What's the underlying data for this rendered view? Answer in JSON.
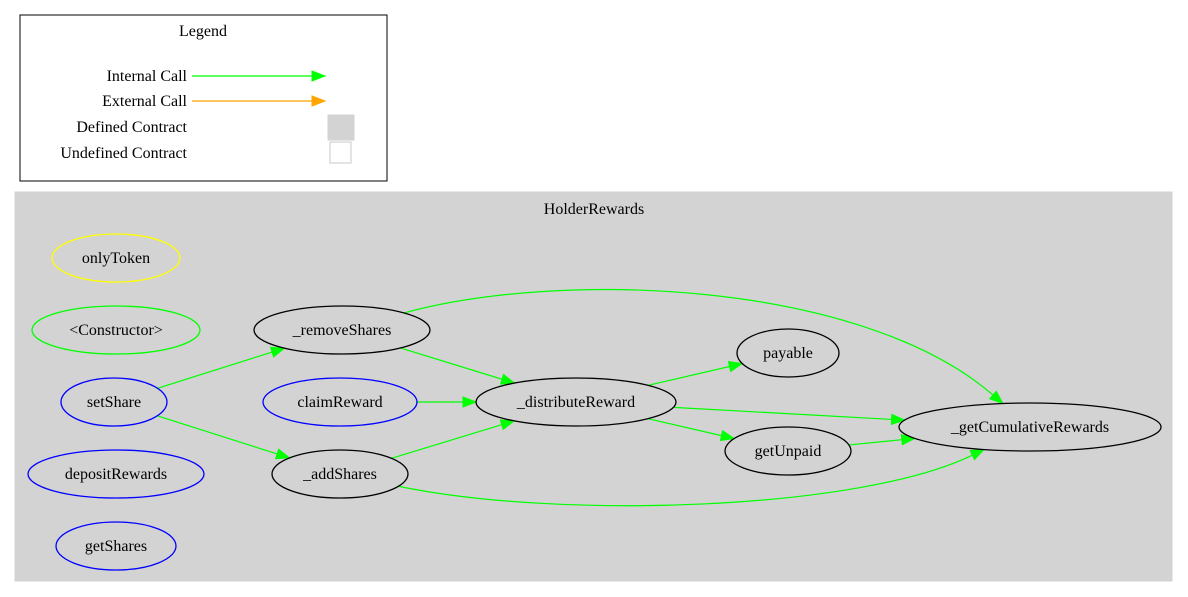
{
  "legend": {
    "title": "Legend",
    "items": [
      {
        "label": "Internal Call",
        "kind": "arrow",
        "color": "#00ff00"
      },
      {
        "label": "External Call",
        "kind": "arrow",
        "color": "#ffa500"
      },
      {
        "label": "Defined Contract",
        "kind": "box",
        "fill": "#d3d3d3",
        "stroke": "#d3d3d3"
      },
      {
        "label": "Undefined Contract",
        "kind": "box",
        "fill": "#ffffff",
        "stroke": "#d3d3d3"
      }
    ]
  },
  "cluster": {
    "title": "HolderRewards",
    "fill": "#d3d3d3"
  },
  "node_colors": {
    "modifier": "#ffff00",
    "constructor": "#00ff00",
    "public": "#0000ff",
    "internal": "#000000"
  },
  "edge_color": "#00ff00",
  "nodes": [
    {
      "id": "onlyToken",
      "label": "onlyToken",
      "type": "modifier"
    },
    {
      "id": "constructor",
      "label": "<Constructor>",
      "type": "constructor"
    },
    {
      "id": "setShare",
      "label": "setShare",
      "type": "public"
    },
    {
      "id": "depositRewards",
      "label": "depositRewards",
      "type": "public"
    },
    {
      "id": "getShares",
      "label": "getShares",
      "type": "public"
    },
    {
      "id": "_removeShares",
      "label": "_removeShares",
      "type": "internal"
    },
    {
      "id": "claimReward",
      "label": "claimReward",
      "type": "public"
    },
    {
      "id": "_addShares",
      "label": "_addShares",
      "type": "internal"
    },
    {
      "id": "_distributeReward",
      "label": "_distributeReward",
      "type": "internal"
    },
    {
      "id": "payable",
      "label": "payable",
      "type": "internal"
    },
    {
      "id": "getUnpaid",
      "label": "getUnpaid",
      "type": "internal"
    },
    {
      "id": "_getCumulativeRewards",
      "label": "_getCumulativeRewards",
      "type": "internal"
    }
  ],
  "edges": [
    {
      "from": "setShare",
      "to": "_removeShares",
      "kind": "internal"
    },
    {
      "from": "setShare",
      "to": "_addShares",
      "kind": "internal"
    },
    {
      "from": "_removeShares",
      "to": "_distributeReward",
      "kind": "internal"
    },
    {
      "from": "_removeShares",
      "to": "_getCumulativeRewards",
      "kind": "internal"
    },
    {
      "from": "claimReward",
      "to": "_distributeReward",
      "kind": "internal"
    },
    {
      "from": "_addShares",
      "to": "_distributeReward",
      "kind": "internal"
    },
    {
      "from": "_addShares",
      "to": "_getCumulativeRewards",
      "kind": "internal"
    },
    {
      "from": "_distributeReward",
      "to": "payable",
      "kind": "internal"
    },
    {
      "from": "_distributeReward",
      "to": "getUnpaid",
      "kind": "internal"
    },
    {
      "from": "_distributeReward",
      "to": "_getCumulativeRewards",
      "kind": "internal"
    },
    {
      "from": "getUnpaid",
      "to": "_getCumulativeRewards",
      "kind": "internal"
    }
  ]
}
